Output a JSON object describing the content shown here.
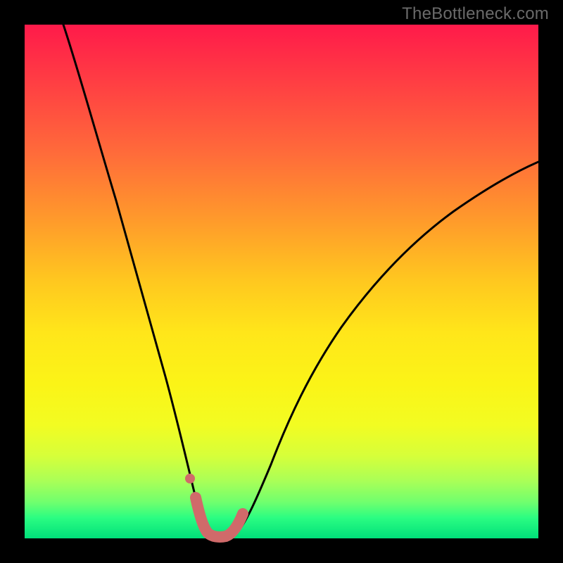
{
  "watermark": "TheBottleneck.com",
  "chart_data": {
    "type": "line",
    "title": "",
    "xlabel": "",
    "ylabel": "",
    "xlim": [
      0,
      100
    ],
    "ylim": [
      0,
      100
    ],
    "grid": false,
    "background": "heatmap-gradient",
    "background_colors_top_to_bottom": [
      "#ff1a4a",
      "#ff9a2b",
      "#ffe61a",
      "#d6ff3a",
      "#00e07a"
    ],
    "series": [
      {
        "name": "bottleneck-curve",
        "x": [
          8,
          12,
          16,
          20,
          24,
          28,
          30,
          32,
          33,
          34,
          36,
          38,
          40,
          42,
          46,
          52,
          60,
          70,
          82,
          94,
          100
        ],
        "y": [
          100,
          86,
          73,
          60,
          47,
          30,
          20,
          10,
          4,
          1,
          0,
          0,
          1,
          5,
          16,
          30,
          45,
          58,
          67,
          73,
          76
        ]
      }
    ],
    "markers": [
      {
        "name": "minimum-highlight",
        "type": "path",
        "x": [
          32.5,
          33.5,
          35,
          37,
          39,
          40,
          41
        ],
        "y": [
          7,
          3,
          0.5,
          0,
          0.5,
          2,
          5
        ]
      },
      {
        "name": "isolated-dot",
        "type": "point",
        "x": 31.3,
        "y": 12
      }
    ]
  }
}
